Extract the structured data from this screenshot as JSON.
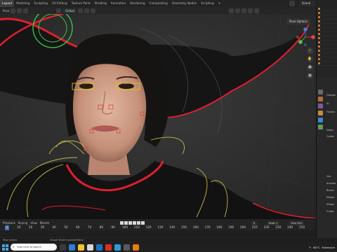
{
  "topbar": {
    "workspace_tabs": [
      "Layout",
      "Modeling",
      "Sculpting",
      "UV Editing",
      "Texture Paint",
      "Shading",
      "Animation",
      "Rendering",
      "Compositing",
      "Geometry Nodes",
      "Scripting",
      "+"
    ],
    "active_tab": "Layout",
    "scene_name": "Scene"
  },
  "viewport_header": {
    "mode": "Pose",
    "view": "View",
    "transform_orientation": "Global",
    "pose_options": "Pose Options"
  },
  "navigation_gizmo": {
    "x_label": "X",
    "y_label": "Y",
    "z_label": "Z"
  },
  "properties_panel": {
    "rows": [
      "Grease",
      "Ar",
      "Flexibl",
      "Defor",
      "Collec",
      "Gro",
      "Inverse",
      "Bones",
      "Displa",
      "Viewp",
      "Custo"
    ]
  },
  "timeline": {
    "playback_label": "Playback",
    "keying_label": "Keying",
    "view_label": "View",
    "marker_label": "Marker",
    "current_frame": "0",
    "start_label": "Start",
    "start_frame": "1",
    "end_label": "End",
    "end_frame": "250",
    "ruler_ticks": [
      "0",
      "10",
      "20",
      "30",
      "40",
      "50",
      "60",
      "70",
      "80",
      "90",
      "100",
      "110",
      "120",
      "130",
      "140",
      "150",
      "160",
      "170",
      "180",
      "190",
      "200",
      "210",
      "220",
      "230",
      "240",
      "250"
    ]
  },
  "status_bar": {
    "left": "Pose Select",
    "middle": "Shape Sheet Context Menu"
  },
  "taskbar": {
    "search_placeholder": "Type here to search",
    "weather_temp": "60°C",
    "weather_text": "Extensive"
  },
  "colors": {
    "accent_blue": "#4772b3",
    "bone_yellow": "#c8b84a",
    "hat_red": "#e01e2e"
  }
}
